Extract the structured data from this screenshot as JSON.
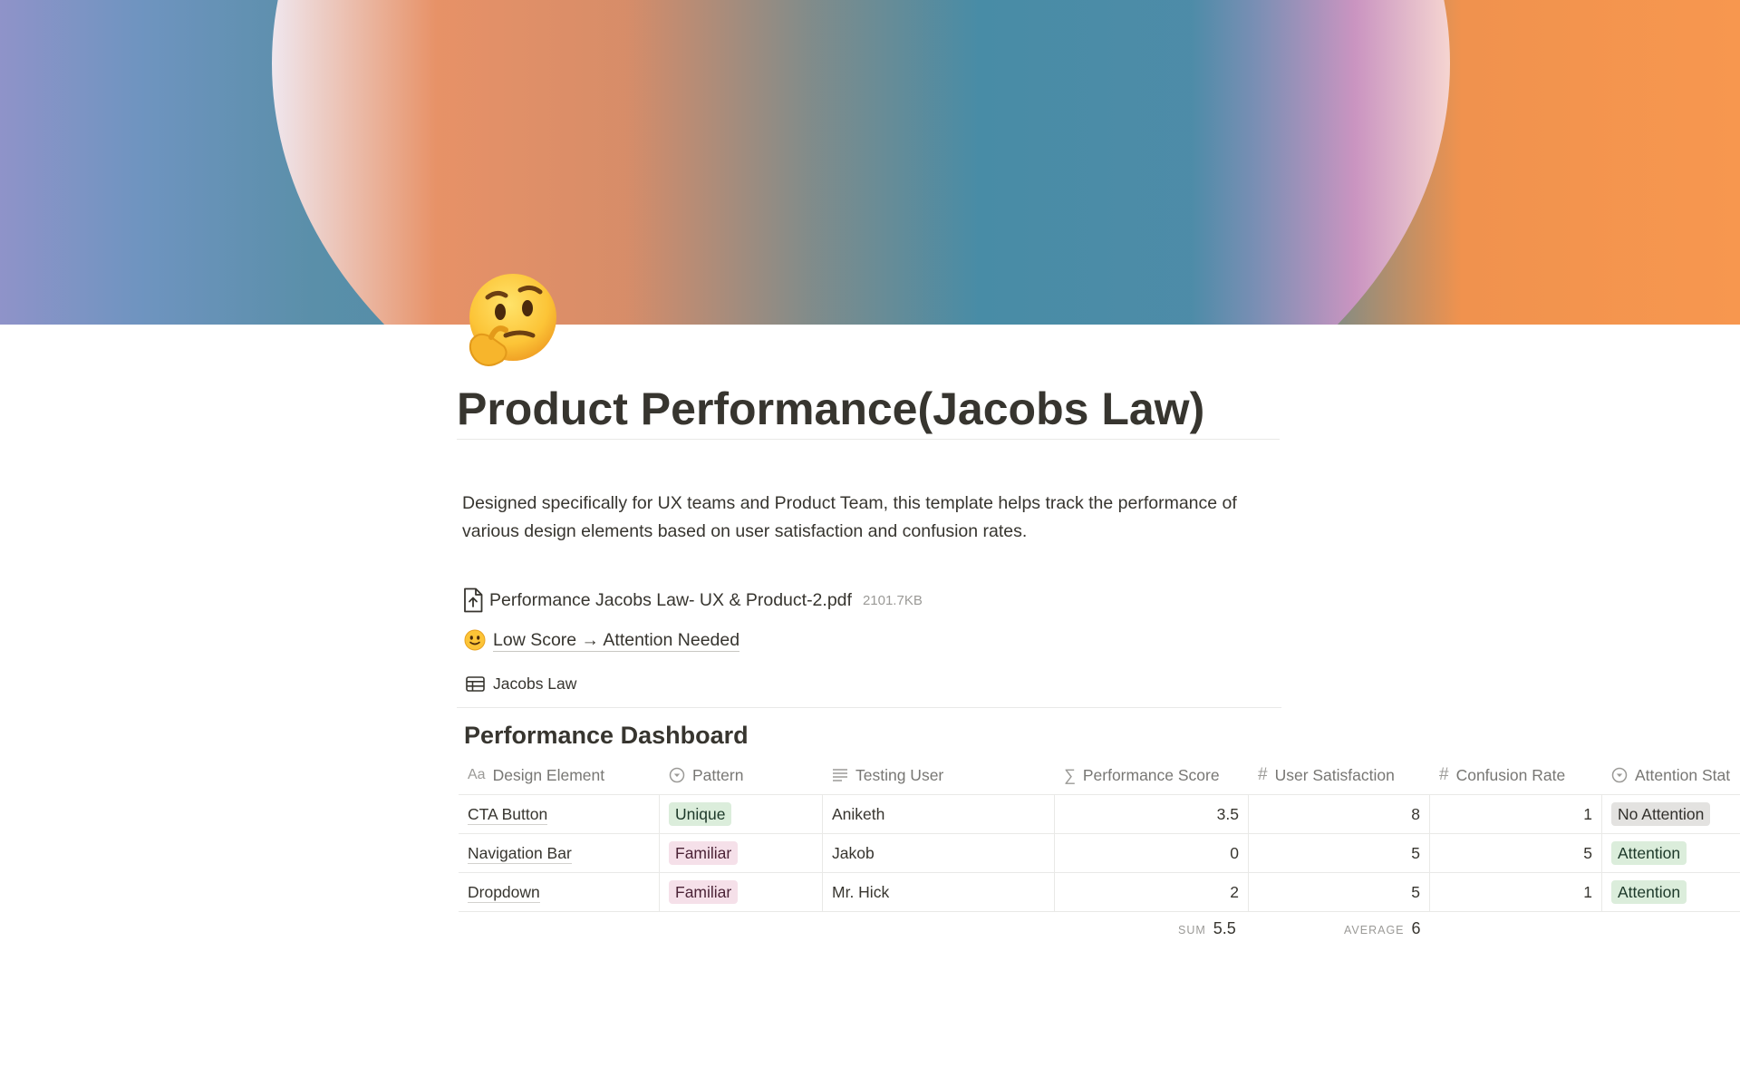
{
  "page": {
    "title": "Product Performance(Jacobs Law)",
    "description": "Designed specifically for UX teams and Product Team, this template helps track the performance of various design elements based on user satisfaction and confusion rates.",
    "icon": "thinking-face-emoji"
  },
  "file": {
    "name": "Performance Jacobs Law- UX & Product-2.pdf",
    "size": "2101.7KB",
    "icon": "file-upload-icon"
  },
  "link": {
    "label": "Low Score → Attention Needed",
    "icon": "slightly-smiling-face-emoji"
  },
  "database_link": {
    "label": "Jacobs Law",
    "icon": "table-icon"
  },
  "dashboard": {
    "title": "Performance Dashboard",
    "columns": [
      {
        "label": "Design Element",
        "icon": "title-aa-icon"
      },
      {
        "label": "Pattern",
        "icon": "select-icon"
      },
      {
        "label": "Testing User",
        "icon": "text-lines-icon"
      },
      {
        "label": "Performance Score",
        "icon": "sigma-formula-icon"
      },
      {
        "label": "User Satisfaction",
        "icon": "hash-number-icon"
      },
      {
        "label": "Confusion Rate",
        "icon": "hash-number-icon"
      },
      {
        "label": "Attention Stat",
        "icon": "select-icon"
      }
    ],
    "rows": [
      {
        "element": "CTA Button",
        "pattern": "Unique",
        "user": "Aniketh",
        "score": "3.5",
        "satisfaction": "8",
        "confusion": "1",
        "attention": "No Attention"
      },
      {
        "element": "Navigation Bar",
        "pattern": "Familiar",
        "user": "Jakob",
        "score": "0",
        "satisfaction": "5",
        "confusion": "5",
        "attention": "Attention"
      },
      {
        "element": "Dropdown",
        "pattern": "Familiar",
        "user": "Mr. Hick",
        "score": "2",
        "satisfaction": "5",
        "confusion": "1",
        "attention": "Attention"
      }
    ],
    "calculations": {
      "score_label": "SUM",
      "score_value": "5.5",
      "satisfaction_label": "AVERAGE",
      "satisfaction_value": "6"
    }
  },
  "colors": {
    "tag_green_bg": "#dbeddb",
    "tag_pink_bg": "#f5e0e9",
    "tag_gray_bg": "#e3e2e0",
    "text": "#37352f",
    "muted": "#787774"
  }
}
